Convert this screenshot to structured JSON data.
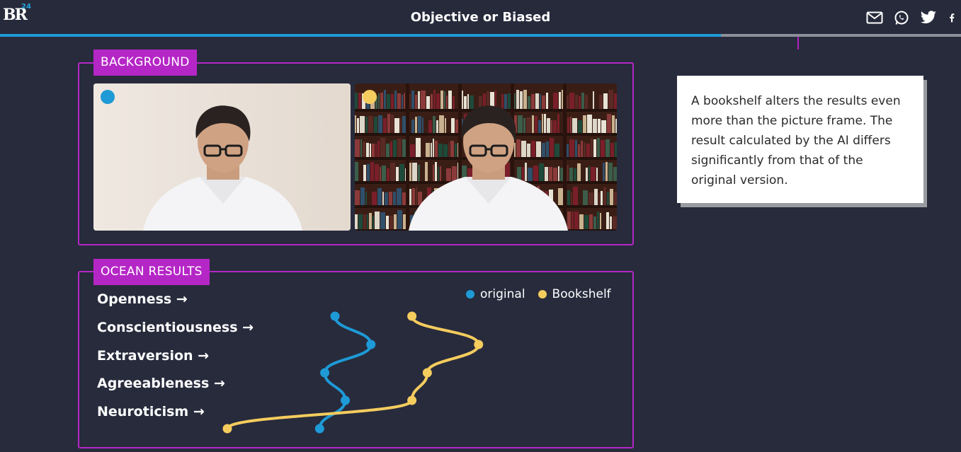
{
  "header": {
    "logo_text": "BR",
    "logo_badge": "24",
    "title": "Objective or Biased",
    "share_icons": [
      "mail-icon",
      "whatsapp-icon",
      "twitter-icon",
      "facebook-icon"
    ]
  },
  "progress": {
    "fraction": 0.75
  },
  "background_section": {
    "label": "BACKGROUND",
    "photos": [
      {
        "name": "original",
        "marker_color": "#1e9ad6"
      },
      {
        "name": "Bookshelf",
        "marker_color": "#f5cc5e"
      }
    ]
  },
  "info_card": {
    "text": "A bookshelf alters the results even more than the picture frame. The result calculated by the AI differs significantly from that of the original version."
  },
  "results_section": {
    "label": "OCEAN RESULTS"
  },
  "colors": {
    "accent": "#b526c6",
    "original": "#1e9ad6",
    "bookshelf": "#f5cc5e",
    "background": "#272b3c"
  },
  "chart_data": {
    "type": "line",
    "categories": [
      "Openness →",
      "Conscientiousness →",
      "Extraversion →",
      "Agreeableness →",
      "Neuroticism →"
    ],
    "xlim": [
      0,
      1
    ],
    "series": [
      {
        "name": "original",
        "color": "#1e9ad6",
        "values": [
          0.46,
          0.53,
          0.44,
          0.48,
          0.43
        ]
      },
      {
        "name": "Bookshelf",
        "color": "#f5cc5e",
        "values": [
          0.61,
          0.74,
          0.64,
          0.61,
          0.25
        ]
      }
    ],
    "legend": "top-right"
  }
}
